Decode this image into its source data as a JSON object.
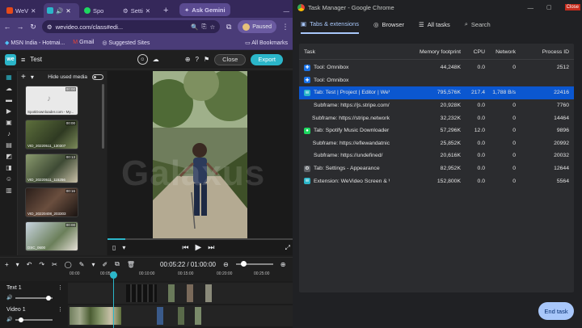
{
  "browser": {
    "tabs": [
      {
        "label": "WeV",
        "active": false
      },
      {
        "label": "",
        "active": true
      },
      {
        "label": "Spo",
        "active": false
      },
      {
        "label": "Setti",
        "active": false
      }
    ],
    "new_tab": "+",
    "ask_gemini": "Ask Gemini",
    "url": "wevideo.com/class#edi...",
    "profile_status": "Paused",
    "bookmarks": [
      "MSN India - Hotmai...",
      "Gmail",
      "Suggested Sites"
    ],
    "all_bookmarks": "All Bookmarks"
  },
  "wevideo": {
    "logo": "we",
    "project_title": "Test",
    "close_label": "Close",
    "export_label": "Export",
    "hide_used_media": "Hide used media",
    "media": [
      {
        "name": "SpotiDownloader.com - My...",
        "duration": "00:00"
      },
      {
        "name": "VID_20220511_130307",
        "duration": "00:00"
      },
      {
        "name": "VID_20220511_115256",
        "duration": "00:13"
      },
      {
        "name": "VID_20220408_203303",
        "duration": "00:16"
      },
      {
        "name": "DSC_0600",
        "duration": "00:00"
      }
    ],
    "timecode": "00:05:22 / 01:00:00",
    "ruler_ticks": [
      "00:00",
      "00:05:00",
      "00:10:00",
      "00:15:00",
      "00:20:00",
      "00:25:00"
    ],
    "tracks": [
      "Text 1",
      "Video 1"
    ],
    "watermark": "Galaxus"
  },
  "task_manager": {
    "title": "Task Manager - Google Chrome",
    "tabs": [
      "Tabs & extensions",
      "Browser",
      "All tasks"
    ],
    "search_placeholder": "Search",
    "columns": [
      "Task",
      "Memory footprint",
      "CPU",
      "Network",
      "Process ID"
    ],
    "rows": [
      {
        "task": "Tool: Omnibox",
        "memory": "44,248K",
        "cpu": "0.0",
        "network": "0",
        "pid": "2512",
        "icon": "puzzle-icon",
        "selected": false
      },
      {
        "task": "Tool: Omnibox",
        "memory": "",
        "cpu": "",
        "network": "",
        "pid": "",
        "icon": "puzzle-icon",
        "selected": false
      },
      {
        "task": "Tab: Test | Project | Editor | WeVi",
        "memory": "795,576K",
        "cpu": "217.4",
        "network": "1,788 B/s",
        "pid": "22416",
        "icon": "wevideo-icon",
        "selected": true
      },
      {
        "task": "Subframe: https://js.stripe.com/",
        "memory": "20,928K",
        "cpu": "0.0",
        "network": "0",
        "pid": "7760",
        "icon": "",
        "selected": false
      },
      {
        "task": "Subframe: https://stripe.network",
        "memory": "32,232K",
        "cpu": "0.0",
        "network": "0",
        "pid": "14464",
        "icon": "",
        "selected": false
      },
      {
        "task": "Tab: Spotify Music Downloader (",
        "memory": "57,296K",
        "cpu": "12.0",
        "network": "0",
        "pid": "9896",
        "icon": "spotify-icon",
        "selected": false
      },
      {
        "task": "Subframe: https://eflewandatnic",
        "memory": "25,852K",
        "cpu": "0.0",
        "network": "0",
        "pid": "20992",
        "icon": "",
        "selected": false
      },
      {
        "task": "Subframe: https://undefined/",
        "memory": "20,616K",
        "cpu": "0.0",
        "network": "0",
        "pid": "20032",
        "icon": "",
        "selected": false
      },
      {
        "task": "Tab: Settings - Appearance",
        "memory": "82,952K",
        "cpu": "0.0",
        "network": "0",
        "pid": "12644",
        "icon": "gear-icon",
        "selected": false
      },
      {
        "task": "Extension: WeVideo Screen & W",
        "memory": "152,800K",
        "cpu": "0.0",
        "network": "0",
        "pid": "5564",
        "icon": "wevideo-icon",
        "selected": false
      }
    ],
    "end_task": "End task",
    "window_close": "Close"
  },
  "colors": {
    "accent": "#0b57d0",
    "wevideo_teal": "#2bb6c9",
    "chrome_purple": "#4a3c78"
  }
}
